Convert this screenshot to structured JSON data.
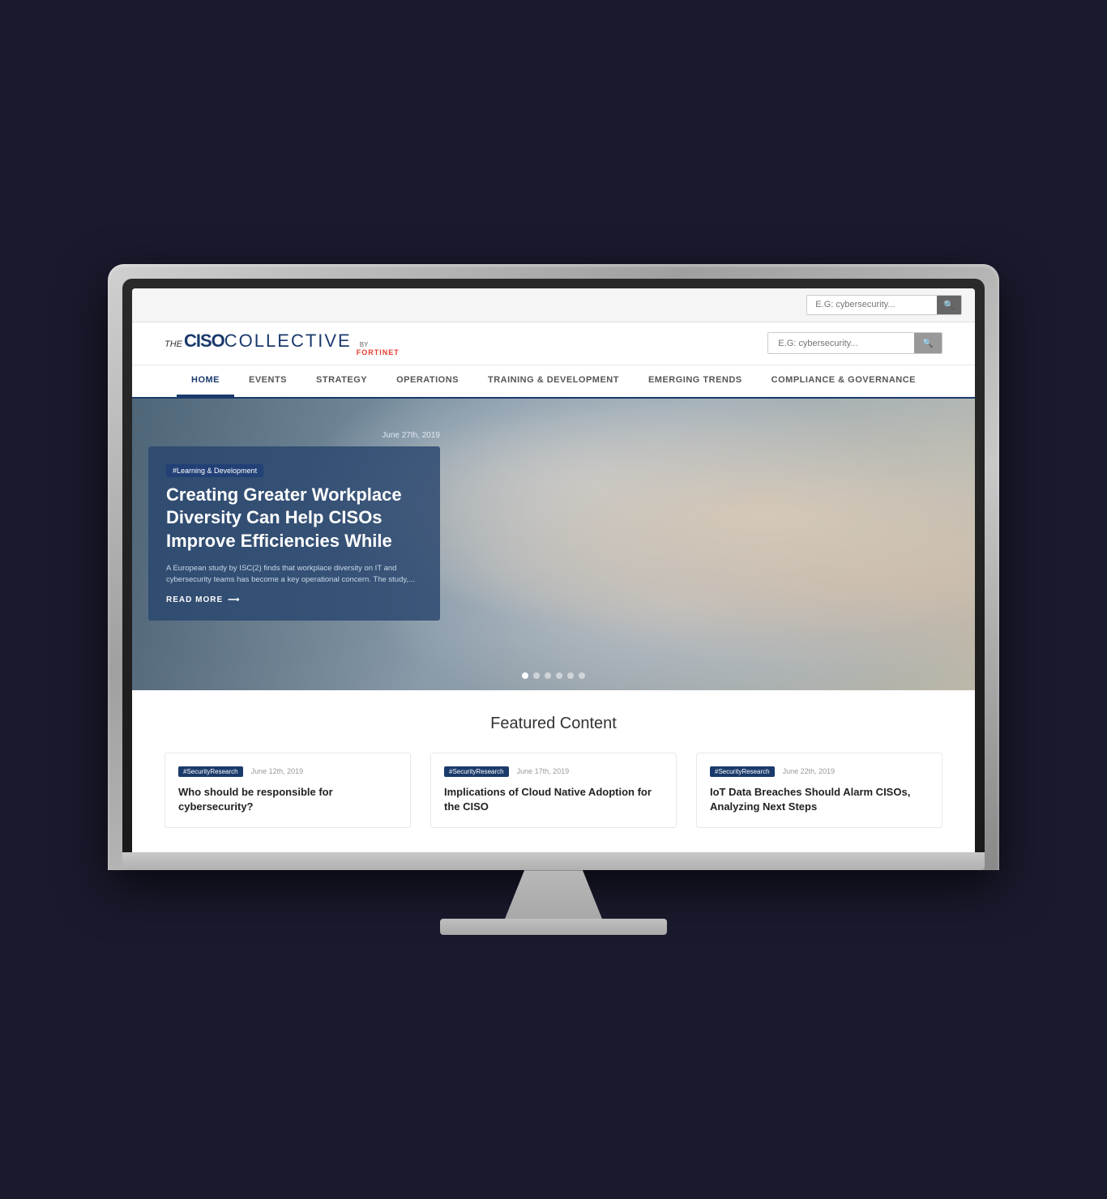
{
  "monitor": {
    "label": "Desktop Monitor"
  },
  "site": {
    "search": {
      "placeholder": "E.G: cybersecurity...",
      "button_label": "🔍"
    },
    "logo": {
      "the": "THE",
      "ciso": "CISO",
      "collective": "COLLECTIVE",
      "by": "by",
      "fortinet": "FORTINET"
    },
    "nav": {
      "items": [
        {
          "label": "HOME",
          "active": true
        },
        {
          "label": "EVENTS",
          "active": false
        },
        {
          "label": "STRATEGY",
          "active": false
        },
        {
          "label": "OPERATIONS",
          "active": false
        },
        {
          "label": "TRAINING & DEVELOPMENT",
          "active": false
        },
        {
          "label": "EMERGING TRENDS",
          "active": false
        },
        {
          "label": "COMPLIANCE & GOVERNANCE",
          "active": false
        }
      ]
    },
    "hero": {
      "tag": "#Learning & Development",
      "date": "June 27th, 2019",
      "title": "Creating Greater Workplace Diversity Can Help CISOs Improve Efficiencies While",
      "description": "A European study by ISC(2) finds that workplace diversity on IT and cybersecurity teams has become a key operational concern. The study,...",
      "read_more": "READ MORE",
      "dots": 6,
      "active_dot": 0
    },
    "featured": {
      "section_title": "Featured Content",
      "cards": [
        {
          "tag": "#SecurityResearch",
          "date": "June 12th, 2019",
          "title": "Who should be responsible for cybersecurity?"
        },
        {
          "tag": "#SecurityResearch",
          "date": "June 17th, 2019",
          "title": "Implications of Cloud Native Adoption for the CISO"
        },
        {
          "tag": "#SecurityResearch",
          "date": "June 22th, 2019",
          "title": "IoT Data Breaches Should Alarm CISOs, Analyzing Next Steps"
        }
      ]
    }
  }
}
